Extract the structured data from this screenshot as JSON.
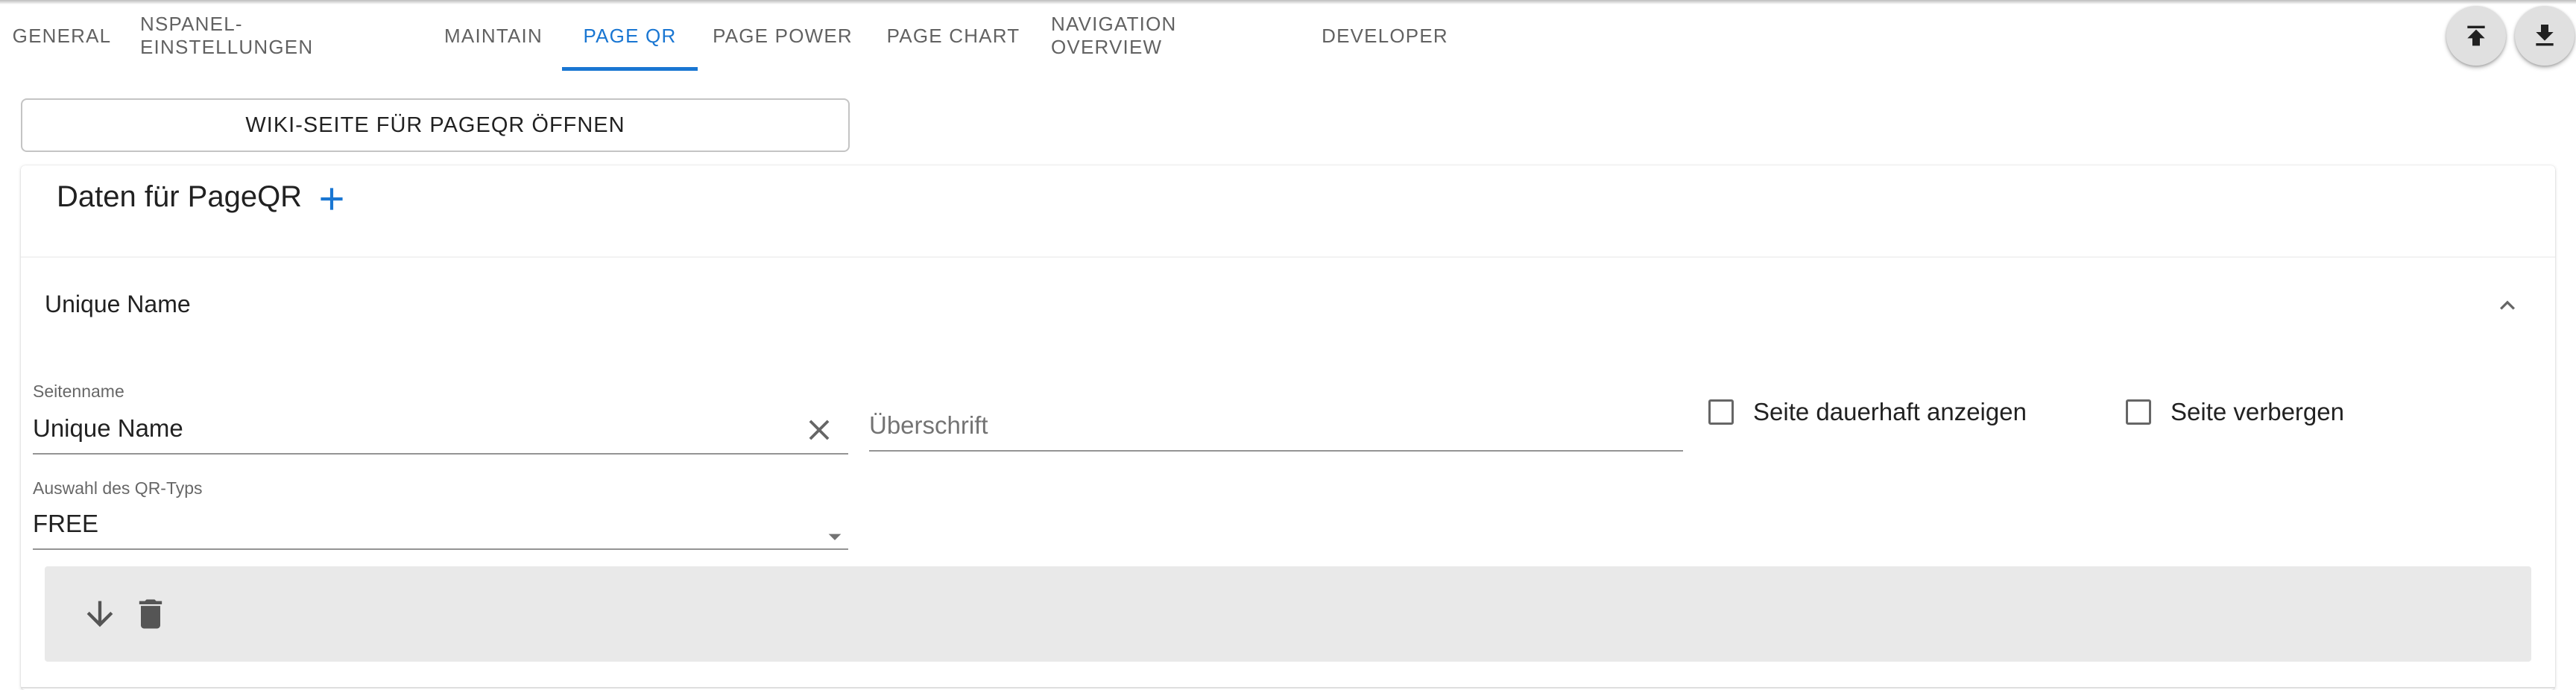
{
  "tabs": [
    {
      "label": "GENERAL"
    },
    {
      "label": "NSPANEL-EINSTELLUNGEN"
    },
    {
      "label": "MAINTAIN"
    },
    {
      "label": "PAGE QR"
    },
    {
      "label": "PAGE POWER"
    },
    {
      "label": "PAGE CHART"
    },
    {
      "label": "NAVIGATION OVERVIEW"
    },
    {
      "label": "DEVELOPER"
    }
  ],
  "active_tab": "PAGE QR",
  "colors": {
    "accent": "#1976d2"
  },
  "toolbar": {
    "upload_icon": "upload-icon",
    "download_icon": "download-icon"
  },
  "wiki_button": {
    "label": "WIKI-SEITE FÜR PAGEQR ÖFFNEN"
  },
  "card": {
    "title": "Daten für PageQR",
    "add_icon": "add-icon",
    "accordion": {
      "title": "Unique Name",
      "expanded": true,
      "fields": {
        "seitenname": {
          "label": "Seitenname",
          "value": "Unique Name"
        },
        "ueberschrift": {
          "placeholder": "Überschrift"
        },
        "dauerhaft": {
          "label": "Seite dauerhaft anzeigen",
          "checked": false
        },
        "verbergen": {
          "label": "Seite verbergen",
          "checked": false
        },
        "qr_typ": {
          "label": "Auswahl des QR-Typs",
          "value": "FREE"
        }
      },
      "actions": {
        "move_down_icon": "arrow-down-icon",
        "delete_icon": "trash-icon"
      }
    }
  }
}
